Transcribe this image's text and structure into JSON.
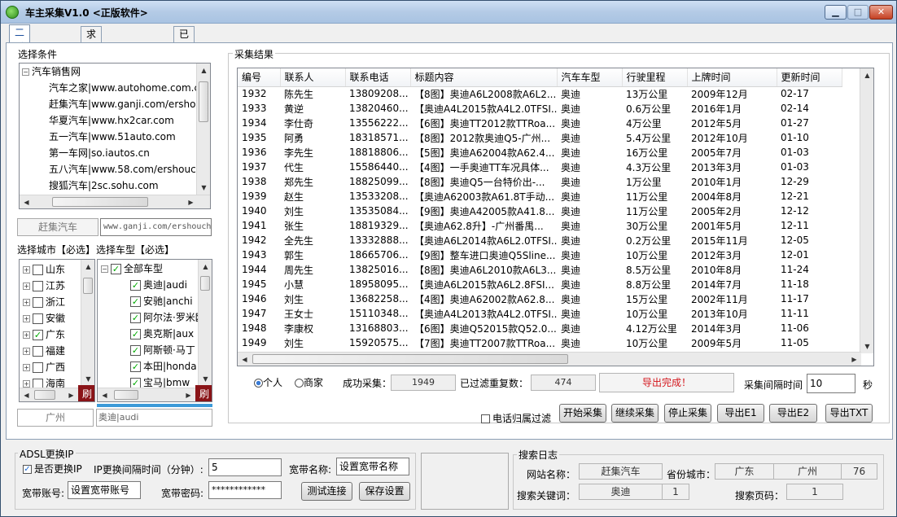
{
  "window": {
    "title": "车主采集V1.0 <正版软件>"
  },
  "tabs": [
    "二手车源搜索",
    "求购汽车客户搜索",
    "已搜索查询"
  ],
  "left": {
    "select_label": "选择条件",
    "site_tree": {
      "root": "汽车销售网",
      "items": [
        "汽车之家|www.autohome.com.cn",
        "赶集汽车|www.ganji.com/ershouche",
        "华夏汽车|www.hx2car.com",
        "五一汽车|www.51auto.com",
        "第一车网|so.iautos.cn",
        "五八汽车|www.58.com/ershouche",
        "搜狐汽车|2sc.sohu.com"
      ]
    },
    "selected_site_name": "赶集汽车",
    "selected_site_url": "www.ganji.com/ershouche",
    "city_label": "选择城市【必选】",
    "model_label": "选择车型【必选】",
    "cities": [
      {
        "name": "山东",
        "checked": false
      },
      {
        "name": "江苏",
        "checked": false
      },
      {
        "name": "浙江",
        "checked": false
      },
      {
        "name": "安徽",
        "checked": false
      },
      {
        "name": "广东",
        "checked": true
      },
      {
        "name": "福建",
        "checked": false
      },
      {
        "name": "广西",
        "checked": false
      },
      {
        "name": "海南",
        "checked": false
      }
    ],
    "models_root": "全部车型",
    "models": [
      "奥迪|audi",
      "安驰|anchi",
      "阿尔法·罗米欧",
      "奥克斯|aux",
      "阿斯顿·马丁",
      "本田|honda",
      "宝马|bmw"
    ],
    "refresh_label": "刷",
    "selected_city": "广州",
    "selected_model": "奥迪|audi"
  },
  "results": {
    "label": "采集结果",
    "columns": [
      "编号",
      "联系人",
      "联系电话",
      "标题内容",
      "汽车车型",
      "行驶里程",
      "上牌时间",
      "更新时间"
    ],
    "rows": [
      [
        "1932",
        "陈先生",
        "13809208...",
        "【8图】奥迪A6L2008款A6L2...",
        "奥迪",
        "13万公里",
        "2009年12月",
        "02-17"
      ],
      [
        "1933",
        "黄逆",
        "13820460...",
        "【奥迪A4L2015款A4L2.0TFSI...",
        "奥迪",
        "0.6万公里",
        "2016年1月",
        "02-14"
      ],
      [
        "1934",
        "李仕奇",
        "13556222...",
        "【6图】奥迪TT2012款TTRoa...",
        "奥迪",
        "4万公里",
        "2012年5月",
        "01-27"
      ],
      [
        "1935",
        "阿勇",
        "18318571...",
        "【8图】2012款奥迪Q5-广州...",
        "奥迪",
        "5.4万公里",
        "2012年10月",
        "01-10"
      ],
      [
        "1936",
        "李先生",
        "18818806...",
        "【5图】奥迪A62004款A62.4...",
        "奥迪",
        "16万公里",
        "2005年7月",
        "01-03"
      ],
      [
        "1937",
        "代生",
        "15586440...",
        "【4图】一手奥迪TT车况具体...",
        "奥迪",
        "4.3万公里",
        "2013年3月",
        "01-03"
      ],
      [
        "1938",
        "郑先生",
        "18825099...",
        "【8图】奥迪Q5一台特价出-...",
        "奥迪",
        "1万公里",
        "2010年1月",
        "12-29"
      ],
      [
        "1939",
        "赵生",
        "13533208...",
        "【奥迪A62003款A61.8T手动...",
        "奥迪",
        "11万公里",
        "2004年8月",
        "12-21"
      ],
      [
        "1940",
        "刘生",
        "13535084...",
        "【9图】奥迪A42005款A41.8...",
        "奥迪",
        "11万公里",
        "2005年2月",
        "12-12"
      ],
      [
        "1941",
        "张生",
        "18819329...",
        "【奥迪A62.8升】-广州番禺...",
        "奥迪",
        "30万公里",
        "2001年5月",
        "12-11"
      ],
      [
        "1942",
        "全先生",
        "13332888...",
        "【奥迪A6L2014款A6L2.0TFSI...",
        "奥迪",
        "0.2万公里",
        "2015年11月",
        "12-05"
      ],
      [
        "1943",
        "郭生",
        "18665706...",
        "【9图】整车进口奥迪Q5Sline...",
        "奥迪",
        "10万公里",
        "2012年3月",
        "12-01"
      ],
      [
        "1944",
        "周先生",
        "13825016...",
        "【8图】奥迪A6L2010款A6L3...",
        "奥迪",
        "8.5万公里",
        "2010年8月",
        "11-24"
      ],
      [
        "1945",
        "小慧",
        "18958095...",
        "【奥迪A6L2015款A6L2.8FSI...",
        "奥迪",
        "8.8万公里",
        "2014年7月",
        "11-18"
      ],
      [
        "1946",
        "刘生",
        "13682258...",
        "【4图】奥迪A62002款A62.8...",
        "奥迪",
        "15万公里",
        "2002年11月",
        "11-17"
      ],
      [
        "1947",
        "王女士",
        "15110348...",
        "【奥迪A4L2013款A4L2.0TFSI...",
        "奥迪",
        "10万公里",
        "2013年10月",
        "11-11"
      ],
      [
        "1948",
        "李康权",
        "13168803...",
        "【6图】奥迪Q52015款Q52.0...",
        "奥迪",
        "4.12万公里",
        "2014年3月",
        "11-06"
      ],
      [
        "1949",
        "刘生",
        "15920575...",
        "【7图】奥迪TT2007款TTRoa...",
        "奥迪",
        "10万公里",
        "2009年5月",
        "11-05"
      ]
    ]
  },
  "status": {
    "radio_personal": "个人",
    "radio_dealer": "商家",
    "success_label": "成功采集：",
    "success_value": "1949",
    "filtered_label": "已过滤重复数：",
    "filtered_value": "474",
    "export_status": "导出完成！",
    "interval_label": "采集间隔时间",
    "interval_value": "10",
    "interval_unit": "秒",
    "phone_filter": "电话归属过滤"
  },
  "buttons": {
    "start": "开始采集",
    "continue": "继续采集",
    "stop": "停止采集",
    "e1": "导出E1",
    "e2": "导出E2",
    "txt": "导出TXT"
  },
  "adsl": {
    "label": "ADSL更换IP",
    "change_ip": "是否更换IP",
    "interval_label": "IP更换间隔时间（分钟）:",
    "interval_value": "5",
    "bb_name_label": "宽带名称:",
    "bb_name_value": "设置宽带名称",
    "bb_account_label": "宽带账号:",
    "bb_account_value": "设置宽带账号",
    "bb_password_label": "宽带密码:",
    "bb_password_value": "************",
    "test_btn": "测试连接",
    "save_btn": "保存设置"
  },
  "log": {
    "label": "搜索日志",
    "site_label": "网站名称：",
    "site_value": "赶集汽车",
    "city_label": "省份城市：",
    "province": "广东",
    "city": "广州",
    "city_count": "76",
    "keyword_label": "搜索关键词：",
    "keyword_value": "奥迪",
    "keyword_count": "1",
    "page_label": "搜索页码：",
    "page_value": "1"
  },
  "colors": {
    "accent": "#1b4f9e",
    "status_red": "#d4161c",
    "refresh_bg": "#8a1418"
  }
}
